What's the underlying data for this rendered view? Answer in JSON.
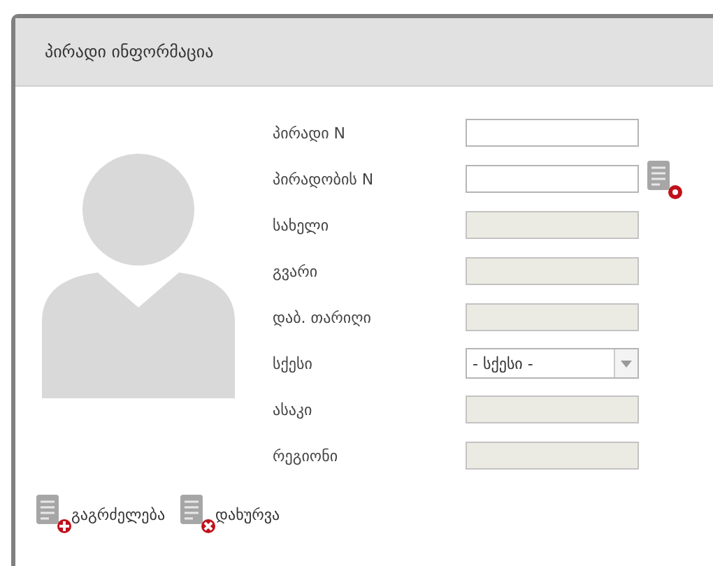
{
  "panel": {
    "title": "პირადი ინფორმაცია"
  },
  "fields": [
    {
      "label": "პირადი N",
      "kind": "text",
      "disabled": false
    },
    {
      "label": "პირადობის N",
      "kind": "text_with_action",
      "disabled": false
    },
    {
      "label": "სახელი",
      "kind": "text",
      "disabled": true
    },
    {
      "label": "გვარი",
      "kind": "text",
      "disabled": true
    },
    {
      "label": "დაბ. თარიღი",
      "kind": "text",
      "disabled": true
    },
    {
      "label": "სქესი",
      "kind": "select",
      "disabled": false,
      "value": "- სქესი -"
    },
    {
      "label": "ასაკი",
      "kind": "text",
      "disabled": true
    },
    {
      "label": "რეგიონი",
      "kind": "text",
      "disabled": true
    }
  ],
  "actions": [
    {
      "label": "გაგრძელება",
      "kind": "add"
    },
    {
      "label": "დახურვა",
      "kind": "close"
    }
  ]
}
